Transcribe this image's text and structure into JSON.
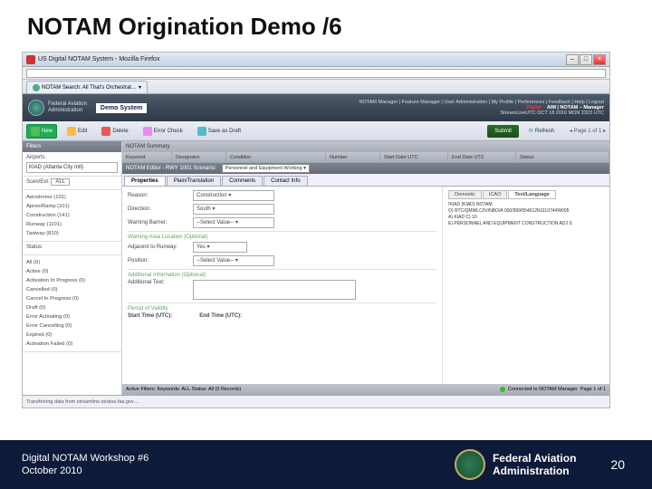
{
  "slide": {
    "title": "NOTAM Origination Demo /6"
  },
  "window": {
    "title": "US Digital NOTAM System - Mozilla Firefox"
  },
  "browser": {
    "tab_icon_name": "globe-icon",
    "tab_title": "NOTAM Search: All That's Orchestrat…",
    "url": ""
  },
  "header": {
    "admin_line1": "Federal Aviation",
    "admin_line2": "Administration",
    "demo_label": "Demo System",
    "links": [
      "NOTAM Manager",
      "Feature Manager",
      "User Administration",
      "My Profile",
      "Preferences",
      "Feedback",
      "Help",
      "Logout"
    ],
    "brand1": "Digital – ",
    "brand2": "AIM",
    "brand_tail": " | NOTAM – Manager",
    "timestamp": "StreamLiveUTC   OCT 18 2010 MON 2323 UTC"
  },
  "toolbar": {
    "new": "New",
    "edit": "Edit",
    "delete": "Delete",
    "error_check": "Error Check",
    "save_draft": "Save as Draft",
    "submit": "Submit",
    "refresh": "Refresh",
    "pager": "Page 1 of 1"
  },
  "sidebar": {
    "filters_title": "Filters",
    "airports_label": "Airports",
    "airports_value": "KIAD (Atlanta City Intl)",
    "scenario_label": "Scen/Evt:",
    "scenario_value": "ALL",
    "scenario_tree": [
      "Aerodrome (101)",
      "Apron/Ramp (101)",
      "Construction (141)",
      "Runway (1101)",
      "Taxiway (810)"
    ],
    "status_label": "Status",
    "status_tree": [
      "All (0)",
      "Active (0)",
      "Activation In Progress (0)",
      "Cancelled (0)",
      "Cancel In Progress (0)",
      "Draft (0)",
      "Error Activating (0)",
      "Error Cancelling (0)",
      "Expired (0)",
      "Activation Failed (0)"
    ]
  },
  "summary": {
    "title": "NOTAM Summary",
    "cols": [
      "Keyword",
      "Designator",
      "Condition",
      "Number",
      "Start Date UTC",
      "End Date UTC",
      "Status"
    ]
  },
  "scenario_bar": {
    "title": "NOTAM Editor - RWY 1001 Scenario:",
    "select_value": "Personnel and Equipment Working"
  },
  "tabs": {
    "items": [
      "Properties",
      "Plain/Translation",
      "Comments",
      "Contact Info"
    ],
    "active": 0
  },
  "form": {
    "reason": {
      "label": "Reason:",
      "value": "Construction"
    },
    "direction": {
      "label": "Direction:",
      "value": "South"
    },
    "warning_barrier": {
      "label": "Warning Barrier:",
      "value": "--Select Value--"
    },
    "warning_area_hdr": "Warning Area Location (Optional)",
    "adjacent_rwy": {
      "label": "Adjacent to Runway:",
      "value": "Yes"
    },
    "position": {
      "label": "Position:",
      "value": "--Select Value--"
    },
    "additional_info_hdr": "Additional Information (Optional)",
    "additional_text_label": "Additional Text:",
    "period_hdr": "Period of Validity",
    "start_label": "Start Time (UTC):",
    "end_label": "End Time (UTC):"
  },
  "right_panel": {
    "tabs": [
      "Domestic",
      "ICAO",
      "Text/Language"
    ],
    "active": 2,
    "lines": [
      "!KIAD (KIAD) NOTAM",
      "O) RTC/QMWLC/IV/NBO/A 000/999/554612N1110744W005",
      "A) KIAD C) 10",
      "E) PERSONNEL AND EQUIPMENT CONSTRUCTION ADJ S"
    ]
  },
  "statusbar": {
    "filters": "Active Filters: Keywords: ALL  Status: All (0 Records)",
    "connection": "Connected to NOTAM Manager",
    "page": "Page 1 of 1",
    "transfer": "Transferring data from streamline.stratus.faa.gov…"
  },
  "footer": {
    "line1": "Digital NOTAM Workshop #6",
    "line2": "October 2010",
    "org1": "Federal Aviation",
    "org2": "Administration",
    "page": "20"
  }
}
